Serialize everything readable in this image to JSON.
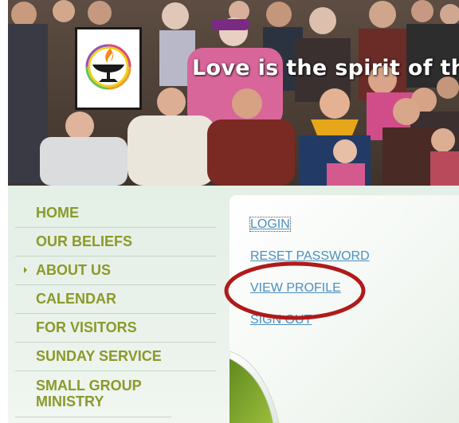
{
  "header": {
    "tagline": "Love is the spirit of th"
  },
  "nav": {
    "items": [
      {
        "label": "HOME",
        "active": false
      },
      {
        "label": "OUR BELIEFS",
        "active": false
      },
      {
        "label": "ABOUT US",
        "active": true
      },
      {
        "label": "CALENDAR",
        "active": false
      },
      {
        "label": "FOR VISITORS",
        "active": false
      },
      {
        "label": "SUNDAY SERVICE",
        "active": false
      },
      {
        "label": "SMALL GROUP MINISTRY",
        "active": false
      }
    ]
  },
  "account_links": {
    "items": [
      {
        "label": "LOGIN"
      },
      {
        "label": "RESET PASSWORD"
      },
      {
        "label": "VIEW PROFILE"
      },
      {
        "label": "SIGN OUT"
      }
    ]
  },
  "colors": {
    "nav_text": "#8a9a2a",
    "link_text": "#4a8fc0",
    "highlight_oval": "#b01a1a",
    "panel_background": "#e4efe6"
  },
  "icons": {
    "logo": "flaming-chalice-icon",
    "active_marker": "triangle-right-icon"
  }
}
